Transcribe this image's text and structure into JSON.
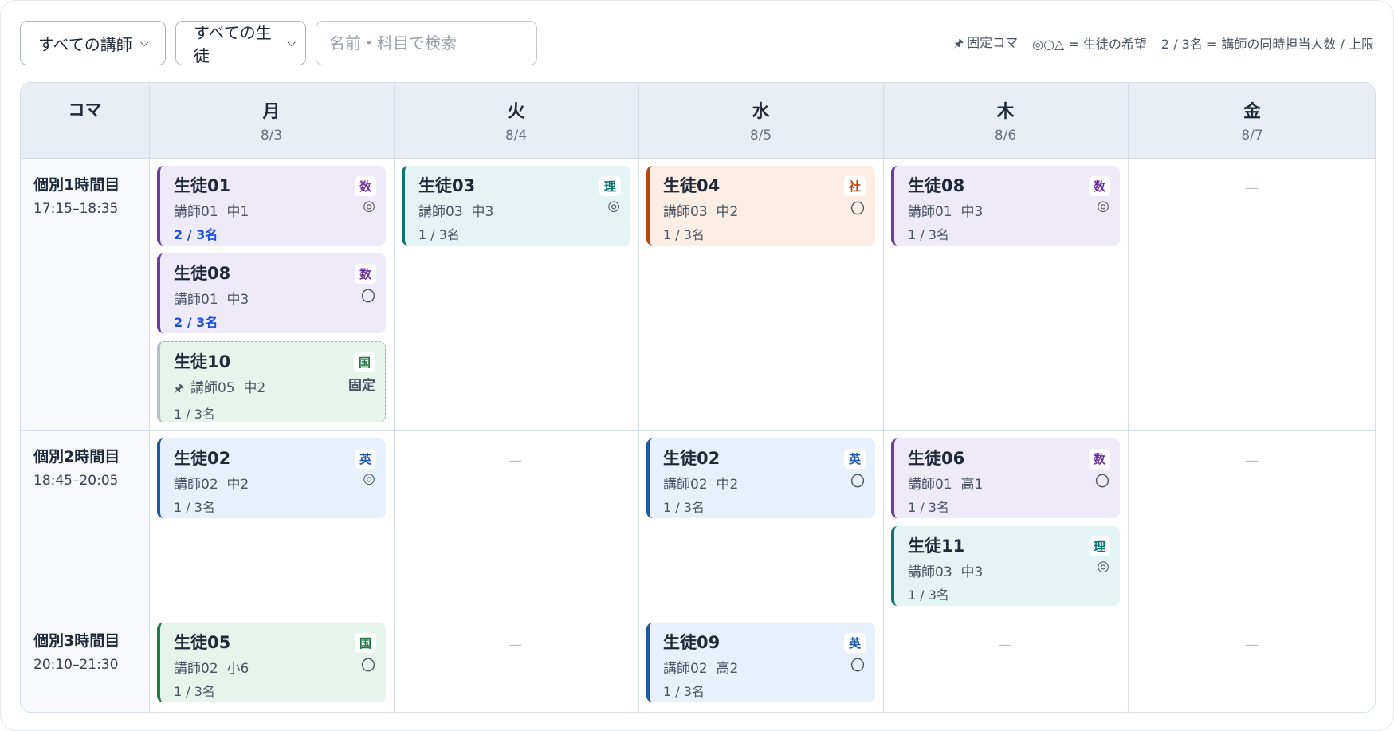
{
  "toolbar": {
    "teacher_select": "すべての講師",
    "student_select": "すべての生徒",
    "search_placeholder": "名前・科目で検索",
    "legend": {
      "fixed": "固定コマ",
      "pref": "◎○△ = 生徒の希望",
      "capacity": "2 / 3名 = 講師の同時担当人数 / 上限"
    }
  },
  "grid": {
    "corner": "コマ",
    "days": [
      {
        "day": "月",
        "date": "8/3"
      },
      {
        "day": "火",
        "date": "8/4"
      },
      {
        "day": "水",
        "date": "8/5"
      },
      {
        "day": "木",
        "date": "8/6"
      },
      {
        "day": "金",
        "date": "8/7"
      }
    ],
    "periods": [
      {
        "name": "個別1時間目",
        "time": "17:15–18:35"
      },
      {
        "name": "個別2時間目",
        "time": "18:45–20:05"
      },
      {
        "name": "個別3時間目",
        "time": "20:10–21:30"
      }
    ],
    "empty": "—"
  },
  "cards": [
    {
      "student": "生徒01",
      "subject": "数",
      "teacher": "講師01",
      "grade": "中1",
      "pref": "◎",
      "capacity": "2 / 3名",
      "full": true,
      "color": "#6b3fa0"
    },
    {
      "student": "生徒08",
      "subject": "数",
      "teacher": "講師01",
      "grade": "中3",
      "pref": "〇",
      "capacity": "2 / 3名",
      "full": true,
      "color": "#6b3fa0"
    },
    {
      "student": "生徒10",
      "subject": "国",
      "teacher": "講師05",
      "grade": "中2",
      "fixed": "固定",
      "capacity": "1 / 3名",
      "color": "#b7c1cc"
    },
    {
      "student": "生徒03",
      "subject": "理",
      "teacher": "講師03",
      "grade": "中3",
      "pref": "◎",
      "capacity": "1 / 3名",
      "color": "#0e7470"
    },
    {
      "student": "生徒04",
      "subject": "社",
      "teacher": "講師03",
      "grade": "中2",
      "pref": "〇",
      "capacity": "1 / 3名",
      "color": "#b8470f"
    },
    {
      "student": "生徒08",
      "subject": "数",
      "teacher": "講師01",
      "grade": "中3",
      "pref": "◎",
      "capacity": "1 / 3名",
      "color": "#6b3fa0"
    },
    {
      "student": "生徒02",
      "subject": "英",
      "teacher": "講師02",
      "grade": "中2",
      "pref": "◎",
      "capacity": "1 / 3名",
      "color": "#1e5aa8"
    },
    {
      "student": "生徒02",
      "subject": "英",
      "teacher": "講師02",
      "grade": "中2",
      "pref": "〇",
      "capacity": "1 / 3名",
      "color": "#1e5aa8"
    },
    {
      "student": "生徒06",
      "subject": "数",
      "teacher": "講師01",
      "grade": "高1",
      "pref": "〇",
      "capacity": "1 / 3名",
      "color": "#6b3fa0"
    },
    {
      "student": "生徒11",
      "subject": "理",
      "teacher": "講師03",
      "grade": "中3",
      "pref": "◎",
      "capacity": "1 / 3名",
      "color": "#0e7470"
    },
    {
      "student": "生徒05",
      "subject": "国",
      "teacher": "講師02",
      "grade": "小6",
      "pref": "〇",
      "capacity": "1 / 3名",
      "color": "#1f7a45"
    },
    {
      "student": "生徒09",
      "subject": "英",
      "teacher": "講師02",
      "grade": "高2",
      "pref": "〇",
      "capacity": "1 / 3名",
      "color": "#1e5aa8"
    }
  ]
}
